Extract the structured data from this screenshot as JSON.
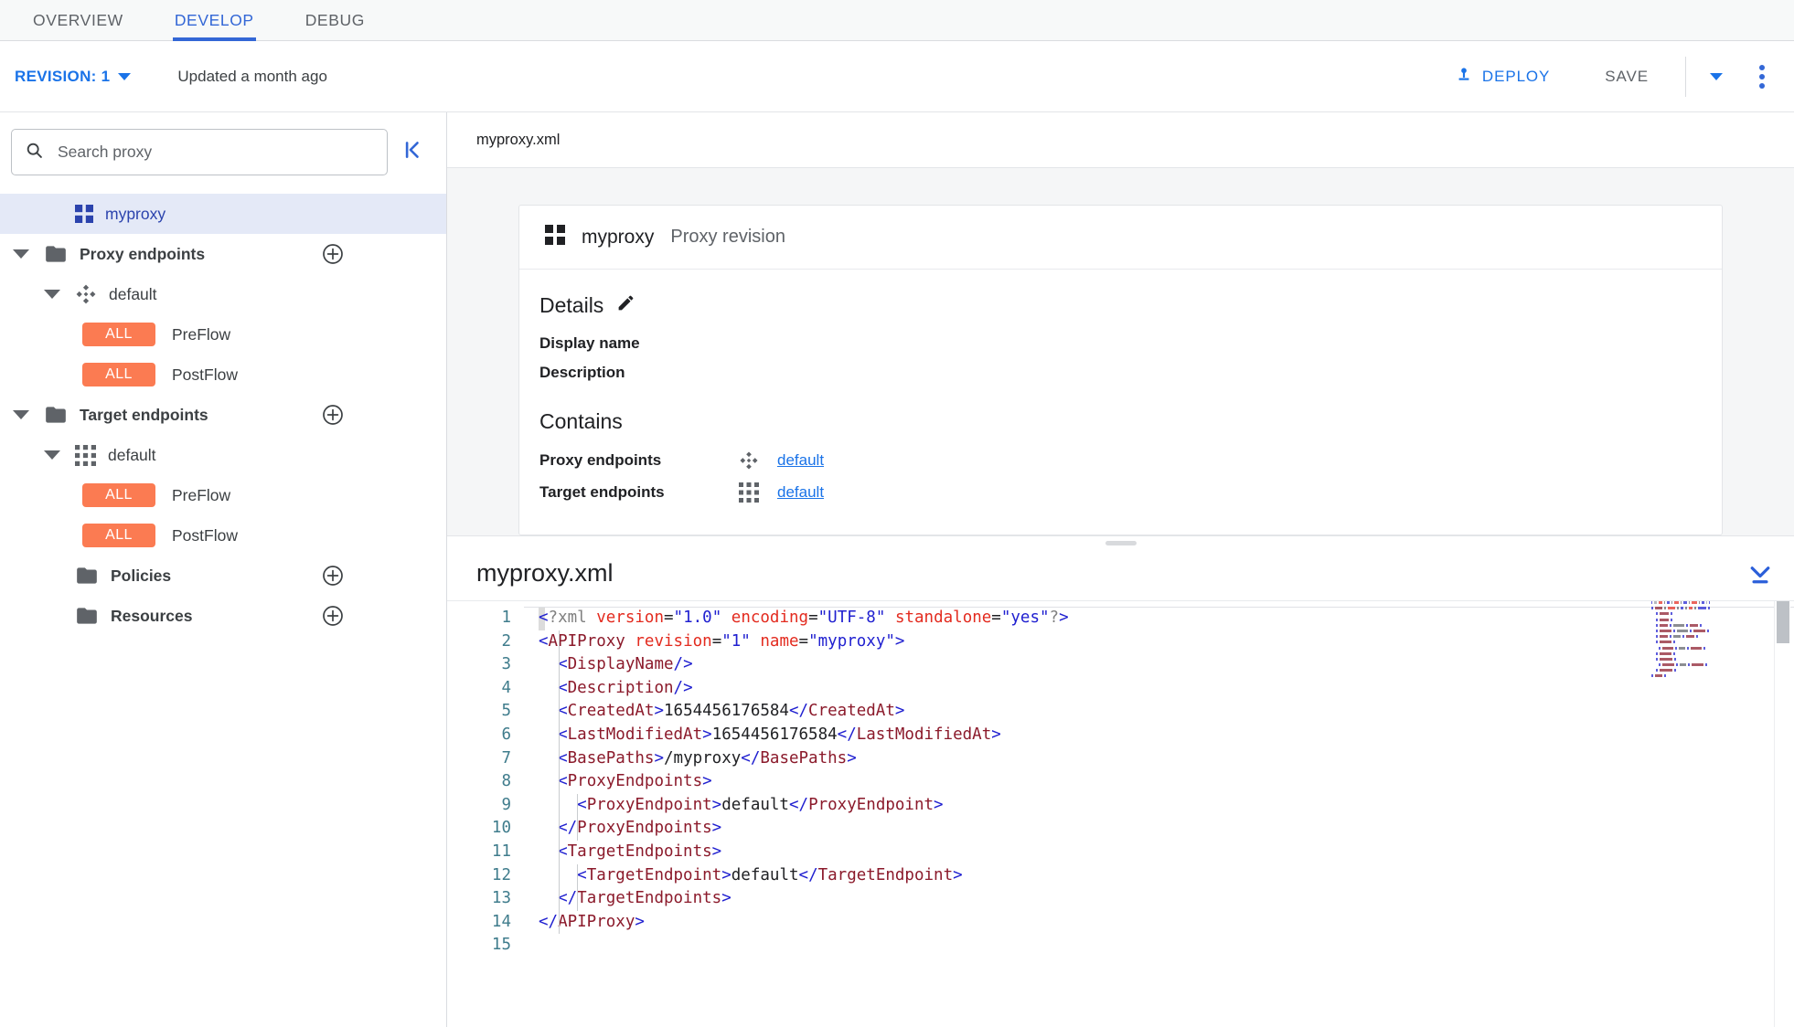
{
  "tabs": [
    {
      "label": "OVERVIEW",
      "active": false
    },
    {
      "label": "DEVELOP",
      "active": true
    },
    {
      "label": "DEBUG",
      "active": false
    }
  ],
  "actionbar": {
    "revision_label": "REVISION: 1",
    "updated_text": "Updated a month ago",
    "deploy_label": "DEPLOY",
    "save_label": "SAVE"
  },
  "sidebar": {
    "search_placeholder": "Search proxy",
    "search_value": "",
    "tree": [
      {
        "label": "myproxy",
        "icon": "grid-4-icon",
        "depth": 1,
        "selected": true,
        "kind": "proxy"
      },
      {
        "label": "Proxy endpoints",
        "icon": "folder-icon",
        "depth": 0,
        "expanded": true,
        "add": true,
        "kind": "folder"
      },
      {
        "label": "default",
        "icon": "proxy-endpoint-icon",
        "depth": 1,
        "expanded": true,
        "kind": "endpoint"
      },
      {
        "label": "PreFlow",
        "chip": "ALL",
        "depth": 2,
        "kind": "flow"
      },
      {
        "label": "PostFlow",
        "chip": "ALL",
        "depth": 2,
        "kind": "flow"
      },
      {
        "label": "Target endpoints",
        "icon": "folder-icon",
        "depth": 0,
        "expanded": true,
        "add": true,
        "kind": "folder"
      },
      {
        "label": "default",
        "icon": "target-endpoint-icon",
        "depth": 1,
        "expanded": true,
        "kind": "endpoint"
      },
      {
        "label": "PreFlow",
        "chip": "ALL",
        "depth": 2,
        "kind": "flow"
      },
      {
        "label": "PostFlow",
        "chip": "ALL",
        "depth": 2,
        "kind": "flow"
      },
      {
        "label": "Policies",
        "icon": "folder-icon",
        "depth": 1,
        "add": true,
        "kind": "folder"
      },
      {
        "label": "Resources",
        "icon": "folder-icon",
        "depth": 1,
        "add": true,
        "kind": "folder"
      }
    ]
  },
  "main": {
    "breadcrumb_file": "myproxy.xml",
    "card": {
      "title": "myproxy",
      "subtitle": "Proxy revision",
      "details_heading": "Details",
      "display_name_label": "Display name",
      "description_label": "Description",
      "contains_heading": "Contains",
      "contains": [
        {
          "label": "Proxy endpoints",
          "icon": "proxy-endpoint-icon",
          "link": "default"
        },
        {
          "label": "Target endpoints",
          "icon": "target-endpoint-icon",
          "link": "default"
        }
      ]
    }
  },
  "editor": {
    "title": "myproxy.xml",
    "line_count": 15,
    "cursor_line": 1,
    "lines": [
      {
        "n": 1,
        "indent": 0,
        "tokens": [
          {
            "t": "pn",
            "v": "<"
          },
          {
            "t": "pi",
            "v": "?xml "
          },
          {
            "t": "at",
            "v": "version"
          },
          {
            "t": "tx",
            "v": "="
          },
          {
            "t": "av",
            "v": "\"1.0\""
          },
          {
            "t": "tx",
            "v": " "
          },
          {
            "t": "at",
            "v": "encoding"
          },
          {
            "t": "tx",
            "v": "="
          },
          {
            "t": "av",
            "v": "\"UTF-8\""
          },
          {
            "t": "tx",
            "v": " "
          },
          {
            "t": "at",
            "v": "standalone"
          },
          {
            "t": "tx",
            "v": "="
          },
          {
            "t": "av",
            "v": "\"yes\""
          },
          {
            "t": "pi",
            "v": "?"
          },
          {
            "t": "pn",
            "v": ">"
          }
        ]
      },
      {
        "n": 2,
        "indent": 0,
        "tokens": [
          {
            "t": "pn",
            "v": "<"
          },
          {
            "t": "tg",
            "v": "APIProxy"
          },
          {
            "t": "tx",
            "v": " "
          },
          {
            "t": "at",
            "v": "revision"
          },
          {
            "t": "tx",
            "v": "="
          },
          {
            "t": "av",
            "v": "\"1\""
          },
          {
            "t": "tx",
            "v": " "
          },
          {
            "t": "at",
            "v": "name"
          },
          {
            "t": "tx",
            "v": "="
          },
          {
            "t": "av",
            "v": "\"myproxy\""
          },
          {
            "t": "pn",
            "v": ">"
          }
        ]
      },
      {
        "n": 3,
        "indent": 1,
        "tokens": [
          {
            "t": "pn",
            "v": "<"
          },
          {
            "t": "tg",
            "v": "DisplayName"
          },
          {
            "t": "pn",
            "v": "/>"
          }
        ]
      },
      {
        "n": 4,
        "indent": 1,
        "tokens": [
          {
            "t": "pn",
            "v": "<"
          },
          {
            "t": "tg",
            "v": "Description"
          },
          {
            "t": "pn",
            "v": "/>"
          }
        ]
      },
      {
        "n": 5,
        "indent": 1,
        "tokens": [
          {
            "t": "pn",
            "v": "<"
          },
          {
            "t": "tg",
            "v": "CreatedAt"
          },
          {
            "t": "pn",
            "v": ">"
          },
          {
            "t": "tx",
            "v": "1654456176584"
          },
          {
            "t": "pn",
            "v": "</"
          },
          {
            "t": "tg",
            "v": "CreatedAt"
          },
          {
            "t": "pn",
            "v": ">"
          }
        ]
      },
      {
        "n": 6,
        "indent": 1,
        "tokens": [
          {
            "t": "pn",
            "v": "<"
          },
          {
            "t": "tg",
            "v": "LastModifiedAt"
          },
          {
            "t": "pn",
            "v": ">"
          },
          {
            "t": "tx",
            "v": "1654456176584"
          },
          {
            "t": "pn",
            "v": "</"
          },
          {
            "t": "tg",
            "v": "LastModifiedAt"
          },
          {
            "t": "pn",
            "v": ">"
          }
        ]
      },
      {
        "n": 7,
        "indent": 1,
        "tokens": [
          {
            "t": "pn",
            "v": "<"
          },
          {
            "t": "tg",
            "v": "BasePaths"
          },
          {
            "t": "pn",
            "v": ">"
          },
          {
            "t": "tx",
            "v": "/myproxy"
          },
          {
            "t": "pn",
            "v": "</"
          },
          {
            "t": "tg",
            "v": "BasePaths"
          },
          {
            "t": "pn",
            "v": ">"
          }
        ]
      },
      {
        "n": 8,
        "indent": 1,
        "tokens": [
          {
            "t": "pn",
            "v": "<"
          },
          {
            "t": "tg",
            "v": "ProxyEndpoints"
          },
          {
            "t": "pn",
            "v": ">"
          }
        ]
      },
      {
        "n": 9,
        "indent": 2,
        "tokens": [
          {
            "t": "pn",
            "v": "<"
          },
          {
            "t": "tg",
            "v": "ProxyEndpoint"
          },
          {
            "t": "pn",
            "v": ">"
          },
          {
            "t": "tx",
            "v": "default"
          },
          {
            "t": "pn",
            "v": "</"
          },
          {
            "t": "tg",
            "v": "ProxyEndpoint"
          },
          {
            "t": "pn",
            "v": ">"
          }
        ]
      },
      {
        "n": 10,
        "indent": 1,
        "tokens": [
          {
            "t": "pn",
            "v": "</"
          },
          {
            "t": "tg",
            "v": "ProxyEndpoints"
          },
          {
            "t": "pn",
            "v": ">"
          }
        ]
      },
      {
        "n": 11,
        "indent": 1,
        "tokens": [
          {
            "t": "pn",
            "v": "<"
          },
          {
            "t": "tg",
            "v": "TargetEndpoints"
          },
          {
            "t": "pn",
            "v": ">"
          }
        ]
      },
      {
        "n": 12,
        "indent": 2,
        "tokens": [
          {
            "t": "pn",
            "v": "<"
          },
          {
            "t": "tg",
            "v": "TargetEndpoint"
          },
          {
            "t": "pn",
            "v": ">"
          },
          {
            "t": "tx",
            "v": "default"
          },
          {
            "t": "pn",
            "v": "</"
          },
          {
            "t": "tg",
            "v": "TargetEndpoint"
          },
          {
            "t": "pn",
            "v": ">"
          }
        ]
      },
      {
        "n": 13,
        "indent": 1,
        "tokens": [
          {
            "t": "pn",
            "v": "</"
          },
          {
            "t": "tg",
            "v": "TargetEndpoints"
          },
          {
            "t": "pn",
            "v": ">"
          }
        ]
      },
      {
        "n": 14,
        "indent": 0,
        "tokens": [
          {
            "t": "pn",
            "v": "</"
          },
          {
            "t": "tg",
            "v": "APIProxy"
          },
          {
            "t": "pn",
            "v": ">"
          }
        ]
      },
      {
        "n": 15,
        "indent": 0,
        "tokens": []
      }
    ]
  },
  "colors": {
    "accent_blue": "#1a73e8",
    "tab_active": "#3367d6",
    "chip_orange": "#fb7b52",
    "selected_row_bg": "#e4e9f7",
    "selected_row_text": "#2b43ad",
    "gutter_text": "#3f7c8c",
    "xml_tag": "#8b1a2b",
    "xml_attr": "#e32b1f",
    "xml_value": "#2020d0"
  }
}
